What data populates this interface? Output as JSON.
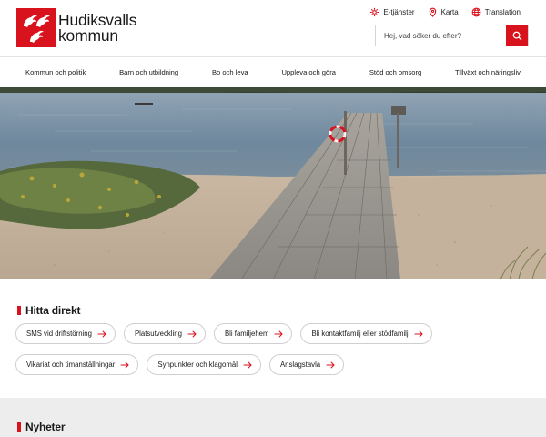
{
  "brand": {
    "name_line1": "Hudiksvalls",
    "name_line2": "kommun",
    "color": "#d9131d"
  },
  "utility": [
    {
      "label": "E-tjänster",
      "icon": "e-services-icon"
    },
    {
      "label": "Karta",
      "icon": "map-pin-icon"
    },
    {
      "label": "Translation",
      "icon": "globe-icon"
    }
  ],
  "search": {
    "placeholder": "Hej, vad söker du efter?"
  },
  "nav": [
    "Kommun och politik",
    "Barn och utbildning",
    "Bo och leva",
    "Uppleva och göra",
    "Stöd och omsorg",
    "Tillväxt och näringsliv"
  ],
  "hero": {
    "alt_icon": "pier-photo"
  },
  "quick_links": {
    "title": "Hitta direkt",
    "rows": [
      [
        "SMS vid driftstörning",
        "Platsutveckling",
        "Bli familjehem",
        "Bli kontaktfamilj eller stödfamilj"
      ],
      [
        "Vikariat och timanställningar",
        "Synpunkter och klagomål",
        "Anslagstavla"
      ]
    ]
  },
  "news": {
    "title": "Nyheter"
  }
}
